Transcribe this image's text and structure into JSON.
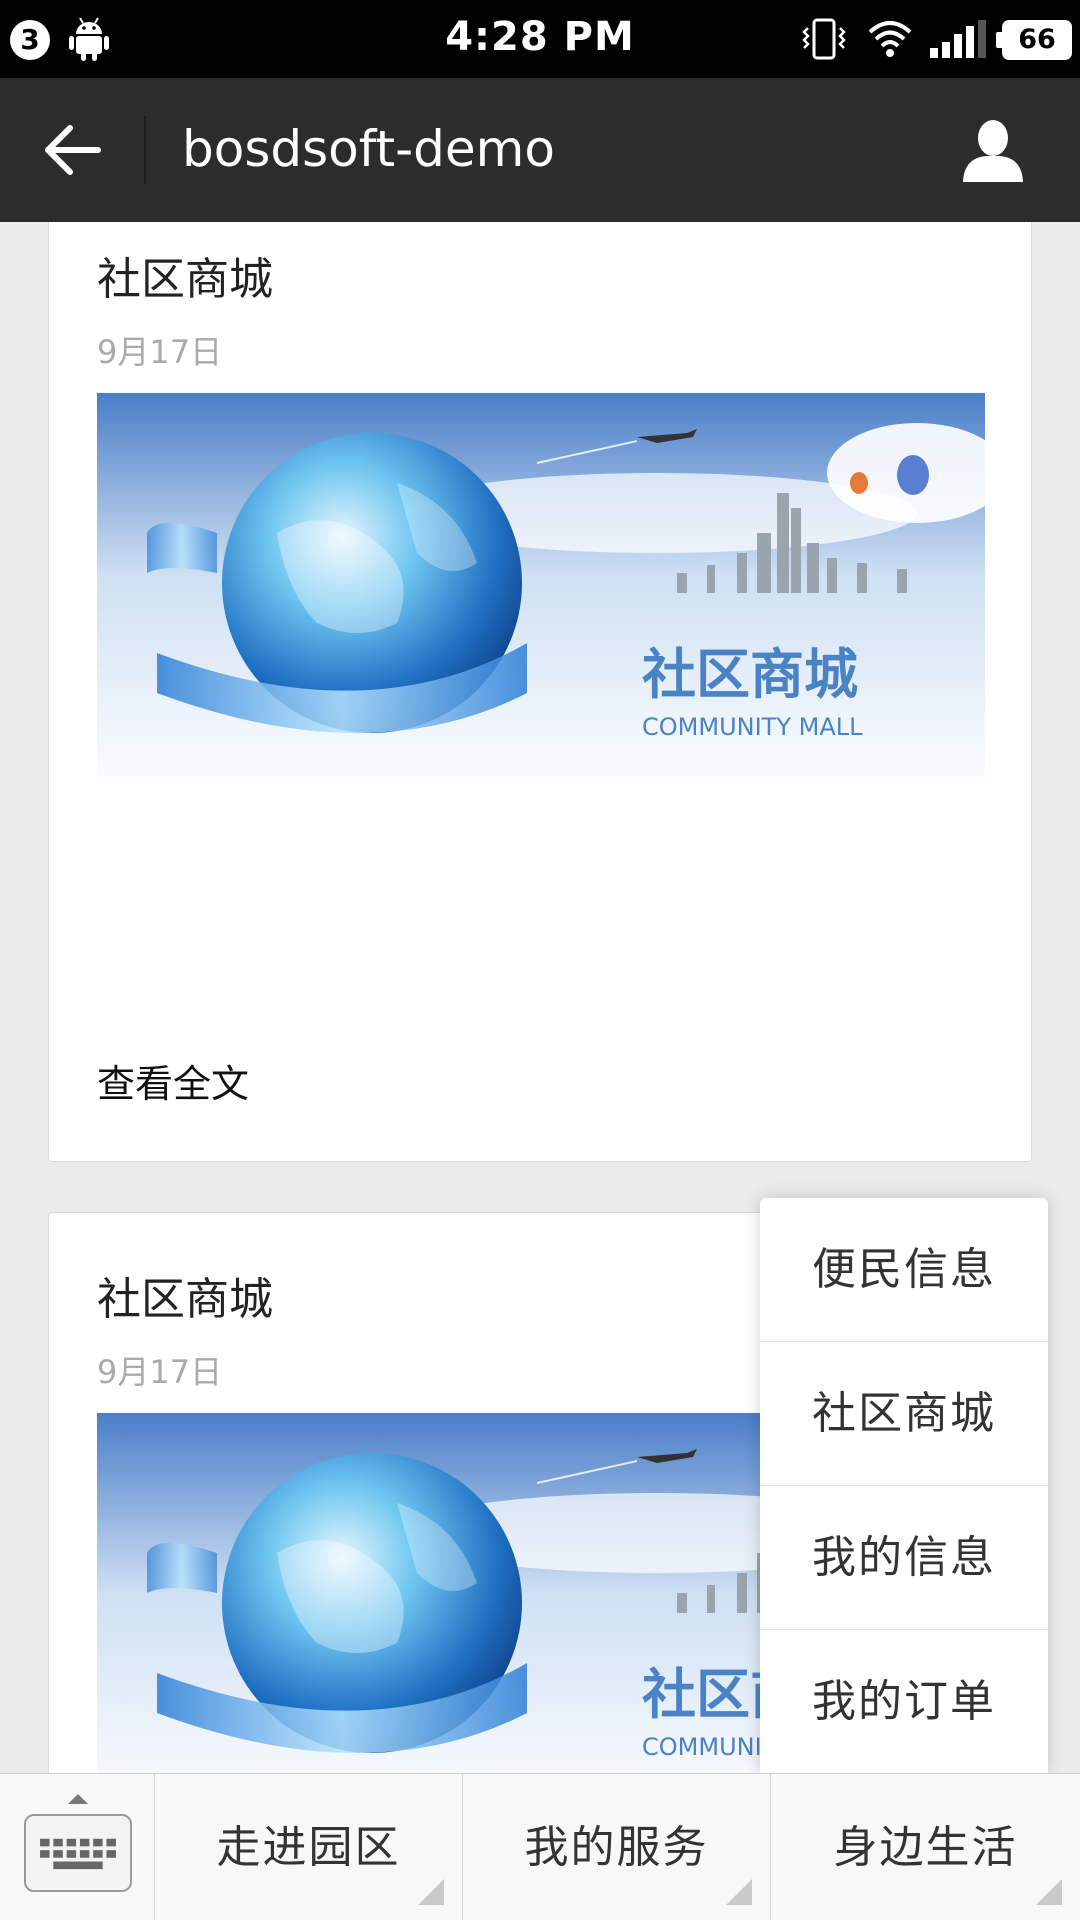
{
  "status_bar": {
    "notification_count": "3",
    "time": "4:28 PM",
    "battery": "66",
    "icons": [
      "notification-badge",
      "android-icon",
      "vibrate-icon",
      "wifi-icon",
      "signal-icon",
      "battery-icon"
    ]
  },
  "title_bar": {
    "back_icon": "arrow-left-icon",
    "title": "bosdsoft-demo",
    "profile_icon": "user-icon"
  },
  "feed": {
    "cards": [
      {
        "title": "社区商城",
        "date": "9月17日",
        "image_caption": "社区商城",
        "image_caption_en": "COMMUNITY MALL",
        "link": "查看全文"
      },
      {
        "title": "社区商城",
        "date": "9月17日",
        "image_caption": "社区商城",
        "image_caption_en": "COMMUNITY MALL"
      }
    ]
  },
  "popup_menu": {
    "items": [
      {
        "label": "便民信息"
      },
      {
        "label": "社区商城"
      },
      {
        "label": "我的信息"
      },
      {
        "label": "我的订单"
      }
    ]
  },
  "bottom_menu": {
    "keyboard_icon": "keyboard-icon",
    "items": [
      {
        "label": "走进园区"
      },
      {
        "label": "我的服务"
      },
      {
        "label": "身边生活"
      }
    ]
  },
  "colors": {
    "title_bar": "#2c2c2c",
    "background": "#ececec",
    "accent_blue": "#4a7fc1"
  }
}
